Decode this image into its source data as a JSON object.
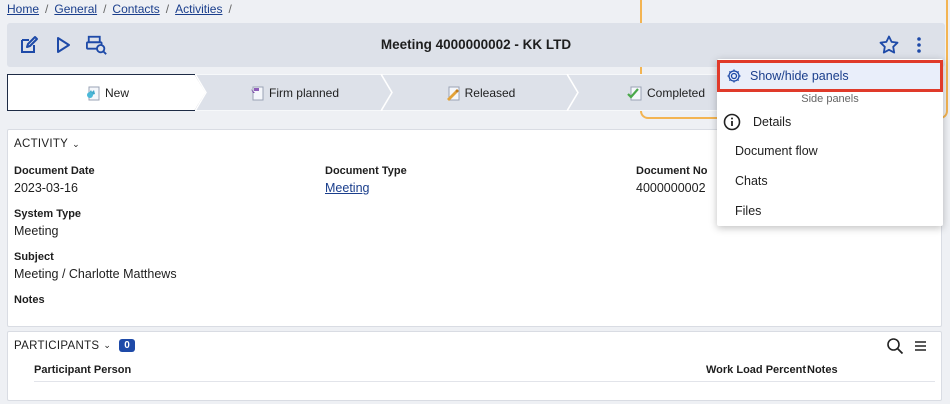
{
  "breadcrumb": [
    "Home",
    "General",
    "Contacts",
    "Activities"
  ],
  "toolbar": {
    "title": "Meeting 4000000002 - KK LTD",
    "icons": [
      "edit-icon",
      "play-icon",
      "preview-icon",
      "star-icon",
      "more-icon"
    ]
  },
  "steps": [
    {
      "label": "New",
      "active": true
    },
    {
      "label": "Firm planned",
      "active": false
    },
    {
      "label": "Released",
      "active": false
    },
    {
      "label": "Completed",
      "active": false
    }
  ],
  "activity": {
    "header": "ACTIVITY",
    "document_date_label": "Document Date",
    "document_date": "2023-03-16",
    "document_type_label": "Document Type",
    "document_type": "Meeting",
    "document_no_label": "Document No",
    "document_no": "4000000002",
    "system_type_label": "System Type",
    "system_type": "Meeting",
    "subject_label": "Subject",
    "subject": "Meeting / Charlotte Matthews",
    "notes_label": "Notes"
  },
  "participants": {
    "header": "PARTICIPANTS",
    "count": "0",
    "columns": [
      "Participant Person",
      "Work Load Percent",
      "Notes"
    ]
  },
  "menu": {
    "show_hide": "Show/hide panels",
    "subheading": "Side panels",
    "items": [
      "Details",
      "Document flow",
      "Chats",
      "Files"
    ]
  },
  "colors": {
    "accent": "#1e4aa8",
    "highlight_border": "#e03a2a",
    "frame": "#f3b452"
  }
}
